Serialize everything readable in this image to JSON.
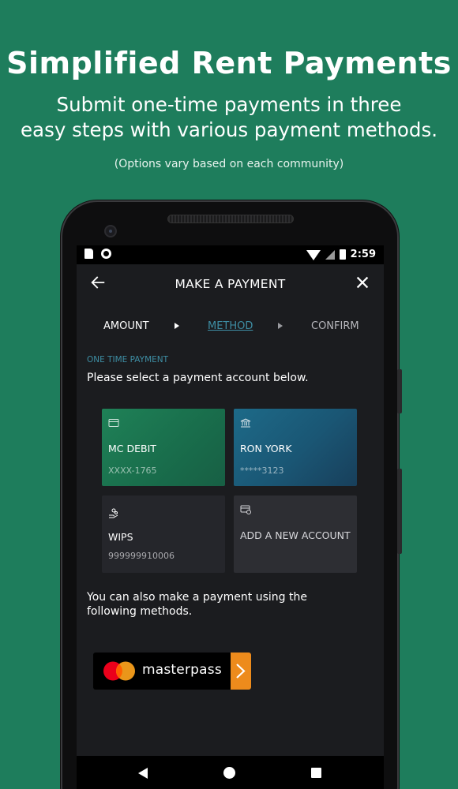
{
  "promo": {
    "title": "Simplified Rent Payments",
    "subtitle_line1": "Submit one-time payments in three",
    "subtitle_line2": "easy steps with various payment methods.",
    "note": "(Options vary based on each community)"
  },
  "status_bar": {
    "time": "2:59",
    "icons": [
      "sd-card-icon",
      "circle-icon",
      "wifi-icon",
      "signal-icon",
      "battery-charging-icon"
    ]
  },
  "app_bar": {
    "title": "MAKE A PAYMENT",
    "back_icon": "arrow-left-icon",
    "close_icon": "close-icon"
  },
  "steps": [
    {
      "label": "AMOUNT",
      "state": "done"
    },
    {
      "label": "METHOD",
      "state": "active"
    },
    {
      "label": "CONFIRM",
      "state": "pending"
    }
  ],
  "section": {
    "label": "ONE TIME PAYMENT",
    "instruction": "Please select a payment account below."
  },
  "accounts": [
    {
      "name": "MC DEBIT",
      "number": "XXXX-1765",
      "icon": "credit-card-icon"
    },
    {
      "name": "RON YORK",
      "number": "*****3123",
      "icon": "bank-icon"
    },
    {
      "name": "WIPS",
      "number": "999999910006",
      "icon": "hand-coins-icon"
    },
    {
      "name": "ADD A NEW ACCOUNT",
      "number": "",
      "icon": "add-card-icon"
    }
  ],
  "other_methods": {
    "text": "You can also make a payment using the following methods.",
    "masterpass_label": "masterpass"
  },
  "colors": {
    "background": "#1e7d5c",
    "accent_teal": "#3e8ea4",
    "mastercard_red": "#eb001b",
    "mastercard_orange": "#f79e1b",
    "masterpass_arrow": "#ed8b1c"
  }
}
